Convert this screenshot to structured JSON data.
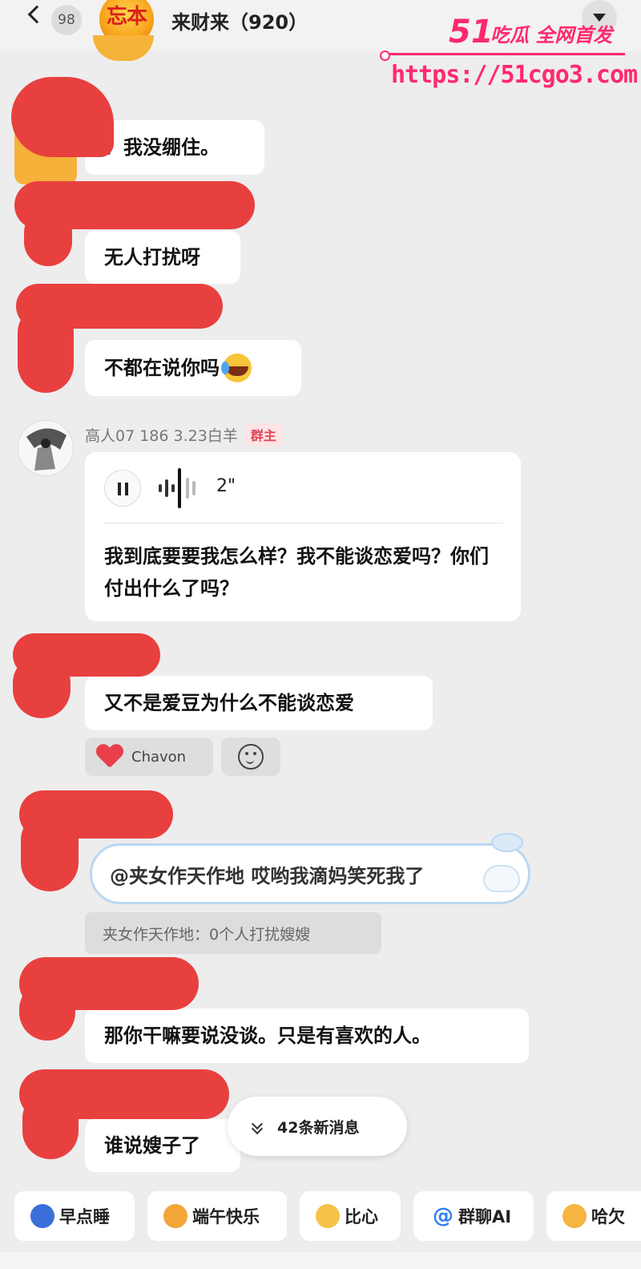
{
  "header": {
    "back_count": "98",
    "group_avatar_text": "忘本",
    "title": "来财来（920）"
  },
  "watermark": {
    "brand_number": "51",
    "brand_tag": "吃瓜 全网首发",
    "url": "https://51cgo3.com",
    "color": "#ff2a6d"
  },
  "messages": {
    "m1": "？我没绷住。",
    "m2": "无人打扰呀",
    "m3": "不都在说你吗",
    "sender": {
      "name_line": "高人07  186  3.23白羊",
      "badge": "群主"
    },
    "voice": {
      "duration": "2\"",
      "transcript": "我到底要要我怎么样？我不能谈恋爱吗？你们付出什么了吗？"
    },
    "m5": "又不是爱豆为什么不能谈恋爱",
    "reaction": {
      "name": "Chavon",
      "icon": "heart-icon"
    },
    "m6": {
      "mention": "@夹女作天作地",
      "text": " 哎哟我滴妈笑死我了"
    },
    "quote": "夹女作天作地：0个人打扰嫂嫂",
    "m7": "那你干嘛要说没谈。只是有喜欢的人。",
    "m8": "谁说嫂子了"
  },
  "new_messages": {
    "label": "42条新消息"
  },
  "quick_replies": [
    {
      "label": "早点睡",
      "icon": "sleep-emoji-icon",
      "color": "#3b6fd8"
    },
    {
      "label": "端午快乐",
      "icon": "dragon-emoji-icon",
      "color": "#f4a53a"
    },
    {
      "label": "比心",
      "icon": "heart-hands-emoji-icon",
      "color": "#f6c34a"
    },
    {
      "label": "群聊AI",
      "icon": "at-icon",
      "color": "#2f7df6"
    },
    {
      "label": "哈欠",
      "icon": "yawn-emoji-icon",
      "color": "#f6b440"
    }
  ],
  "colors": {
    "redaction": "#e8403f",
    "bubble": "#ffffff",
    "background": "#ededed"
  }
}
